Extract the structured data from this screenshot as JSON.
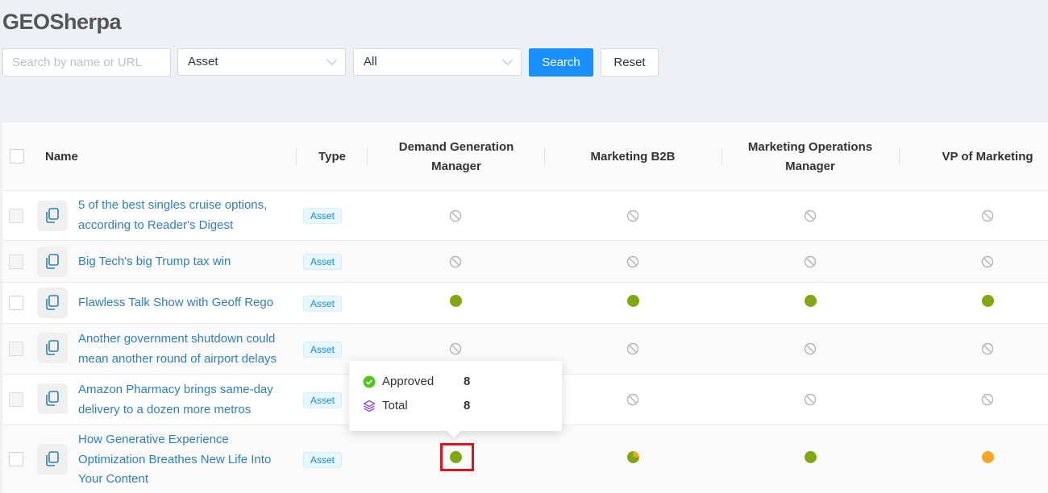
{
  "app": {
    "title": "GEOSherpa"
  },
  "filters": {
    "search_placeholder": "Search by name or URL",
    "search_value": "",
    "type_value": "Asset",
    "status_value": "All",
    "search_button": "Search",
    "reset_button": "Reset"
  },
  "table": {
    "columns": {
      "name": "Name",
      "type": "Type",
      "persona1": "Demand Generation Manager",
      "persona2": "Marketing B2B",
      "persona3": "Marketing Operations Manager",
      "persona4": "VP of Marketing"
    },
    "rows": [
      {
        "name": "5 of the best singles cruise options, according to Reader's Digest",
        "type": "Asset",
        "statuses": [
          "none",
          "none",
          "none",
          "none"
        ]
      },
      {
        "name": "Big Tech's big Trump tax win",
        "type": "Asset",
        "statuses": [
          "none",
          "none",
          "none",
          "none"
        ]
      },
      {
        "name": "Flawless Talk Show with Geoff Rego",
        "type": "Asset",
        "statuses": [
          "approved",
          "approved",
          "approved",
          "approved"
        ]
      },
      {
        "name": "Another government shutdown could mean another round of airport delays",
        "type": "Asset",
        "statuses": [
          "none",
          "none",
          "none",
          "none"
        ]
      },
      {
        "name": "Amazon Pharmacy brings same-day delivery to a dozen more metros",
        "type": "Asset",
        "statuses": [
          "none",
          "none",
          "none",
          "none"
        ]
      },
      {
        "name": "How Generative Experience Optimization Breathes New Life Into Your Content",
        "type": "Asset",
        "statuses": [
          "approved",
          "partial",
          "approved",
          "pending"
        ]
      }
    ]
  },
  "popover": {
    "approved_label": "Approved",
    "approved_value": "8",
    "total_label": "Total",
    "total_value": "8"
  },
  "colors": {
    "accent": "#1890ff",
    "link": "#2f7fb8",
    "approved": "#7fa613",
    "pending": "#f6a623",
    "highlight": "#e0131c"
  },
  "icons": {
    "none": "ban-icon",
    "approved": "status-dot-approved",
    "partial": "status-dot-partial",
    "pending": "status-dot-pending",
    "row": "copy-document-icon"
  }
}
